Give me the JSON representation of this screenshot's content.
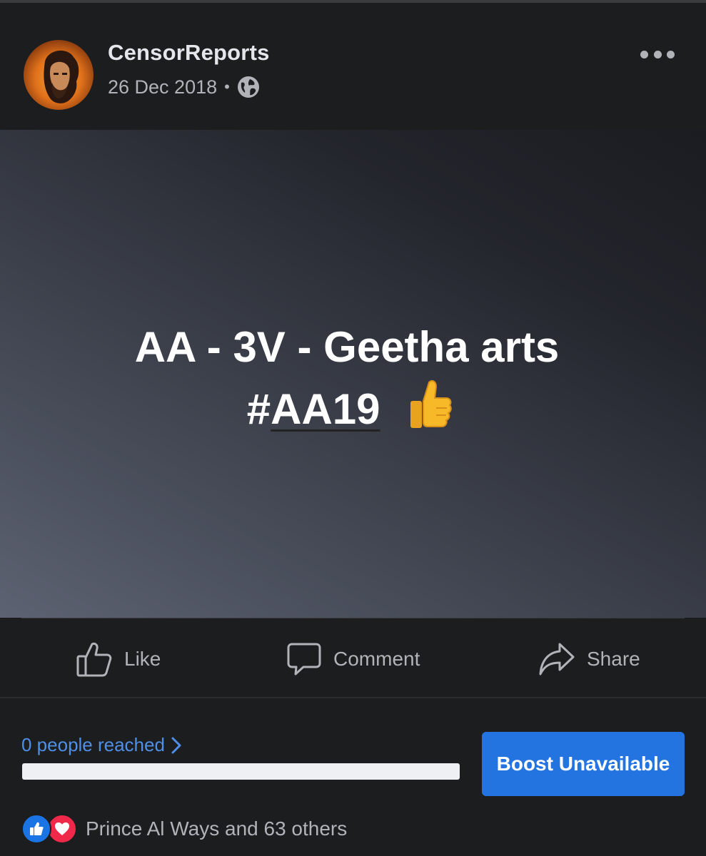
{
  "post": {
    "author": "CensorReports",
    "date": "26 Dec 2018",
    "separator": "•",
    "privacy_icon": "globe-icon",
    "menu_icon": "more-horizontal-icon",
    "text_line1": "AA - 3V - Geetha arts",
    "hashtag_symbol": "#",
    "hashtag": "AA19",
    "emoji": "thumbs-up-emoji"
  },
  "actions": {
    "like": "Like",
    "comment": "Comment",
    "share": "Share"
  },
  "insights": {
    "reach": "0 people reached",
    "boost": "Boost Unavailable",
    "reactions_text": "Prince Al Ways and 63 others"
  },
  "colors": {
    "background": "#18191a",
    "link": "#4f8fe8",
    "boost_button": "#2374e1",
    "like_reaction": "#1b74e4",
    "love_reaction": "#f02849"
  }
}
